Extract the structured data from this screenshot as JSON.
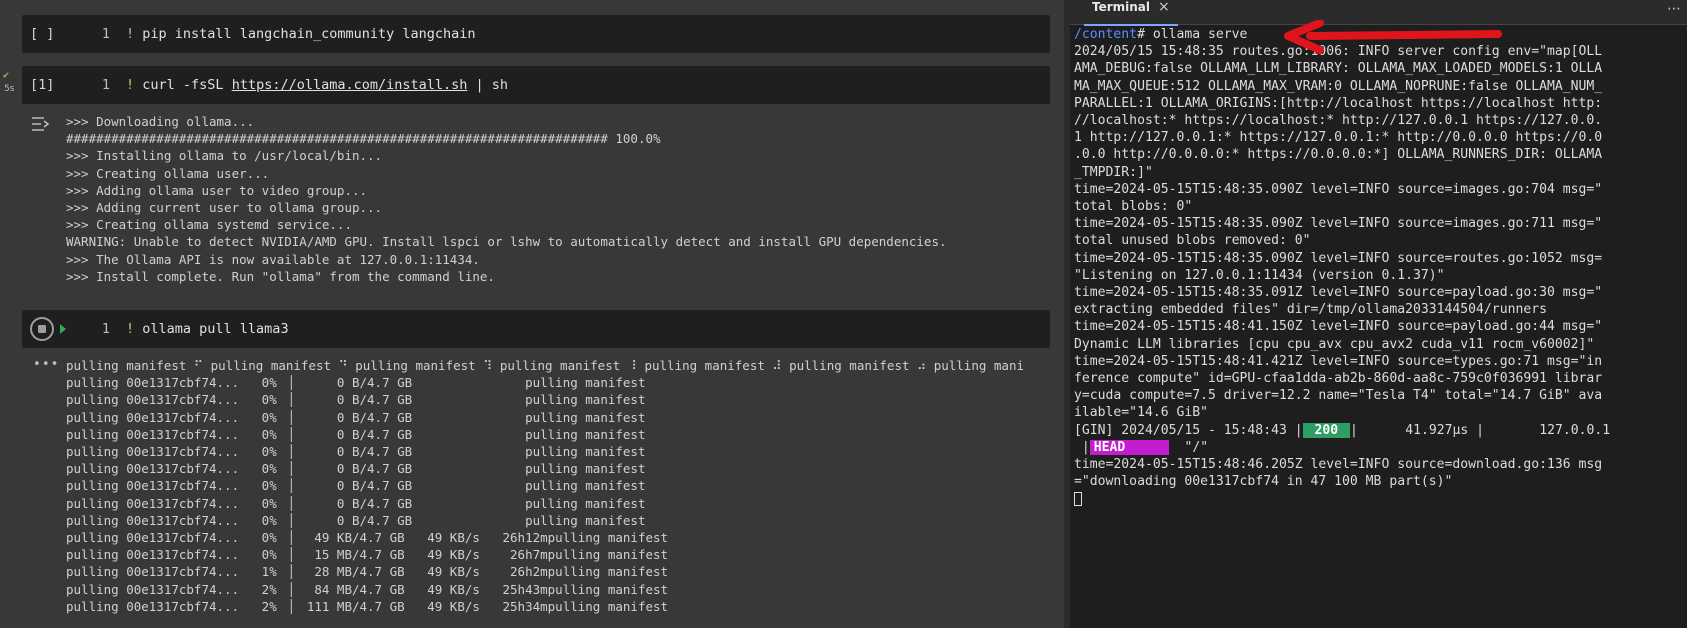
{
  "notebook": {
    "cells": [
      {
        "prompt": "[ ]",
        "line_no": "1",
        "bang": "!",
        "code": " pip install langchain_community langchain"
      },
      {
        "prompt": "[1]",
        "line_no": "1",
        "bang": "!",
        "code_prefix": " curl -fsSL ",
        "code_link": "https://ollama.com/install.sh",
        "code_suffix": " | sh",
        "exec_time": "5s"
      },
      {
        "line_no": "1",
        "bang": "!",
        "code": " ollama pull llama3"
      }
    ],
    "install_output": [
      ">>> Downloading ollama...",
      "######################################################################## 100.0%",
      ">>> Installing ollama to /usr/local/bin...",
      ">>> Creating ollama user...",
      ">>> Adding ollama user to video group...",
      ">>> Adding current user to ollama group...",
      ">>> Creating ollama systemd service...",
      "WARNING: Unable to detect NVIDIA/AMD GPU. Install lspci or lshw to automatically detect and install GPU dependencies.",
      ">>> The Ollama API is now available at 127.0.0.1:11434.",
      ">>> Install complete. Run \"ollama\" from the command line."
    ],
    "pull_output": [
      "pulling manifest ⠋ pulling manifest ⠙ pulling manifest ⠹ pulling manifest ⠸ pulling manifest ⠼ pulling manifest ⠴ pulling mani",
      "pulling 00e1317cbf74...   0% ▕      0 B/4.7 GB               pulling manifest",
      "pulling 00e1317cbf74...   0% ▕      0 B/4.7 GB               pulling manifest",
      "pulling 00e1317cbf74...   0% ▕      0 B/4.7 GB               pulling manifest",
      "pulling 00e1317cbf74...   0% ▕      0 B/4.7 GB               pulling manifest",
      "pulling 00e1317cbf74...   0% ▕      0 B/4.7 GB               pulling manifest",
      "pulling 00e1317cbf74...   0% ▕      0 B/4.7 GB               pulling manifest",
      "pulling 00e1317cbf74...   0% ▕      0 B/4.7 GB               pulling manifest",
      "pulling 00e1317cbf74...   0% ▕      0 B/4.7 GB               pulling manifest",
      "pulling 00e1317cbf74...   0% ▕      0 B/4.7 GB               pulling manifest",
      "pulling 00e1317cbf74...   0% ▕   49 KB/4.7 GB   49 KB/s   26h12mpulling manifest",
      "pulling 00e1317cbf74...   0% ▕   15 MB/4.7 GB   49 KB/s    26h7mpulling manifest",
      "pulling 00e1317cbf74...   1% ▕   28 MB/4.7 GB   49 KB/s    26h2mpulling manifest",
      "pulling 00e1317cbf74...   2% ▕   84 MB/4.7 GB   49 KB/s   25h43mpulling manifest",
      "pulling 00e1317cbf74...   2% ▕  111 MB/4.7 GB   49 KB/s   25h34mpulling manifest"
    ]
  },
  "terminal": {
    "tab_label": "Terminal",
    "close_glyph": "×",
    "more_glyph": "⋯",
    "cwd": "/content",
    "prompt_rest": "# ollama serve",
    "lines": [
      "2024/05/15 15:48:35 routes.go:1006: INFO server config env=\"map[OLL",
      "AMA_DEBUG:false OLLAMA_LLM_LIBRARY: OLLAMA_MAX_LOADED_MODELS:1 OLLA",
      "MA_MAX_QUEUE:512 OLLAMA_MAX_VRAM:0 OLLAMA_NOPRUNE:false OLLAMA_NUM_",
      "PARALLEL:1 OLLAMA_ORIGINS:[http://localhost https://localhost http:",
      "//localhost:* https://localhost:* http://127.0.0.1 https://127.0.0.",
      "1 http://127.0.0.1:* https://127.0.0.1:* http://0.0.0.0 https://0.0",
      ".0.0 http://0.0.0.0:* https://0.0.0.0:*] OLLAMA_RUNNERS_DIR: OLLAMA",
      "_TMPDIR:]\"",
      "time=2024-05-15T15:48:35.090Z level=INFO source=images.go:704 msg=\"",
      "total blobs: 0\"",
      "time=2024-05-15T15:48:35.090Z level=INFO source=images.go:711 msg=\"",
      "total unused blobs removed: 0\"",
      "time=2024-05-15T15:48:35.090Z level=INFO source=routes.go:1052 msg=",
      "\"Listening on 127.0.0.1:11434 (version 0.1.37)\"",
      "time=2024-05-15T15:48:35.091Z level=INFO source=payload.go:30 msg=\"",
      "extracting embedded files\" dir=/tmp/ollama2033144504/runners",
      "time=2024-05-15T15:48:41.150Z level=INFO source=payload.go:44 msg=\"",
      "Dynamic LLM libraries [cpu cpu_avx cpu_avx2 cuda_v11 rocm_v60002]\"",
      "time=2024-05-15T15:48:41.421Z level=INFO source=types.go:71 msg=\"in",
      "ference compute\" id=GPU-cfaa1dda-ab2b-860d-aa8c-759c0f036991 librar",
      "y=cuda compute=7.5 driver=12.2 name=\"Tesla T4\" total=\"14.7 GiB\" ava",
      "ilable=\"14.6 GiB\""
    ],
    "gin_prefix": "[GIN] 2024/05/15 - 15:48:43 |",
    "gin_status": " 200 ",
    "gin_mid": "|      41.927µs |       127.0.0.1",
    "gin_lead": " |",
    "gin_method": "HEAD     ",
    "gin_path": "  \"/\"",
    "tail_lines": [
      "time=2024-05-15T15:48:46.205Z level=INFO source=download.go:136 msg",
      "=\"downloading 00e1317cbf74 in 47 100 MB part(s)\""
    ]
  },
  "annotation_color": "#e0141b"
}
